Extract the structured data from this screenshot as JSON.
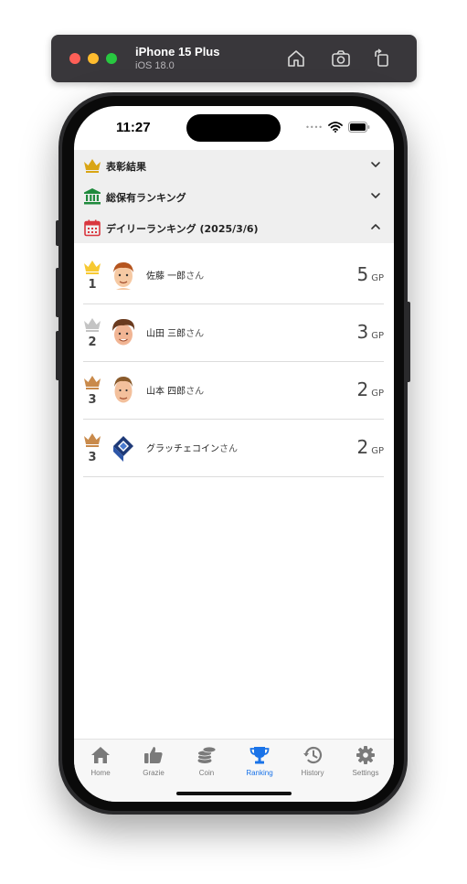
{
  "simulator": {
    "device": "iPhone 15 Plus",
    "os": "iOS 18.0"
  },
  "status_bar": {
    "time": "11:27",
    "signal_dots": "••••"
  },
  "sections": [
    {
      "label": "表彰結果",
      "icon": "crown-icon",
      "expanded": false
    },
    {
      "label": "総保有ランキング",
      "icon": "bank-icon",
      "expanded": false
    },
    {
      "label": "デイリーランキング (2025/3/6)",
      "icon": "calendar-icon",
      "expanded": true
    }
  ],
  "ranking": [
    {
      "rank": "1",
      "name": "佐藤 一郎",
      "suffix": "さん",
      "score": "5",
      "unit": "GP",
      "crown_color": "#f7c932"
    },
    {
      "rank": "2",
      "name": "山田 三郎",
      "suffix": "さん",
      "score": "3",
      "unit": "GP",
      "crown_color": "#c4c4c4"
    },
    {
      "rank": "3",
      "name": "山本 四郎",
      "suffix": "さん",
      "score": "2",
      "unit": "GP",
      "crown_color": "#c98a4b"
    },
    {
      "rank": "3",
      "name": "グラッチェコイン",
      "suffix": "さん",
      "score": "2",
      "unit": "GP",
      "crown_color": "#c98a4b"
    }
  ],
  "tabs": [
    {
      "label": "Home",
      "icon": "home-icon",
      "active": false
    },
    {
      "label": "Grazie",
      "icon": "thumbs-up-icon",
      "active": false
    },
    {
      "label": "Coin",
      "icon": "coins-icon",
      "active": false
    },
    {
      "label": "Ranking",
      "icon": "trophy-icon",
      "active": true
    },
    {
      "label": "History",
      "icon": "history-icon",
      "active": false
    },
    {
      "label": "Settings",
      "icon": "gear-icon",
      "active": false
    }
  ],
  "colors": {
    "accent": "#1a73e8",
    "gold": "#f7c932",
    "silver": "#c4c4c4",
    "bronze": "#c98a4b"
  }
}
